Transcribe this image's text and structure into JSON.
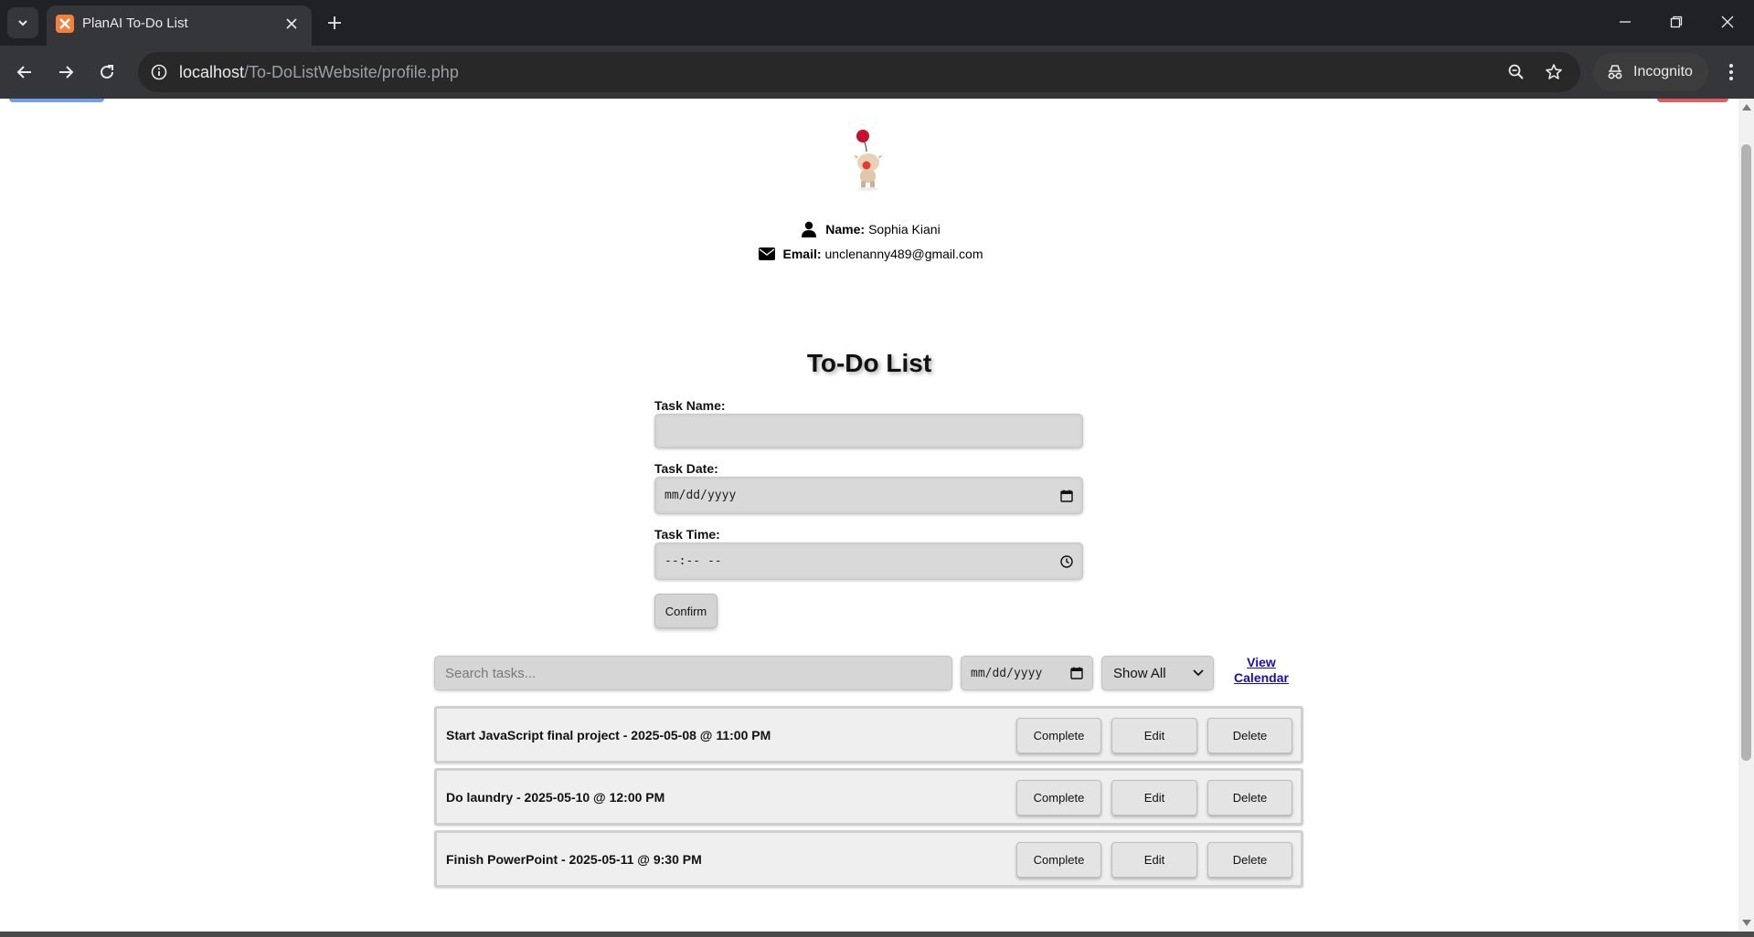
{
  "browser": {
    "tab_title": "PlanAI To-Do List",
    "url_host": "localhost",
    "url_path": "/To-DoListWebsite/profile.php",
    "incognito_label": "Incognito"
  },
  "profile": {
    "name_label": "Name:",
    "name_value": "Sophia Kiani",
    "email_label": "Email:",
    "email_value": "unclenanny489@gmail.com"
  },
  "todo": {
    "title": "To-Do List",
    "task_name_label": "Task Name:",
    "task_name_value": "",
    "task_date_label": "Task Date:",
    "task_date_placeholder": "mm/dd/yyyy",
    "task_time_label": "Task Time:",
    "task_time_placeholder": "--:-- --",
    "confirm_label": "Confirm"
  },
  "filters": {
    "search_placeholder": "Search tasks...",
    "date_placeholder": "mm/dd/yyyy",
    "show_selected": "Show All",
    "calendar_line1": "View",
    "calendar_line2": "Calendar"
  },
  "tasks": [
    {
      "text": "Start JavaScript final project - 2025-05-08 @ 11:00 PM",
      "complete": "Complete",
      "edit": "Edit",
      "delete": "Delete"
    },
    {
      "text": "Do laundry - 2025-05-10 @ 12:00 PM",
      "complete": "Complete",
      "edit": "Edit",
      "delete": "Delete"
    },
    {
      "text": "Finish PowerPoint - 2025-05-11 @ 9:30 PM",
      "complete": "Complete",
      "edit": "Edit",
      "delete": "Delete"
    }
  ],
  "colors": {
    "chrome_dark": "#202124",
    "toolbar": "#35363a",
    "link": "#1a0dab",
    "favicon": "#f4803c"
  }
}
